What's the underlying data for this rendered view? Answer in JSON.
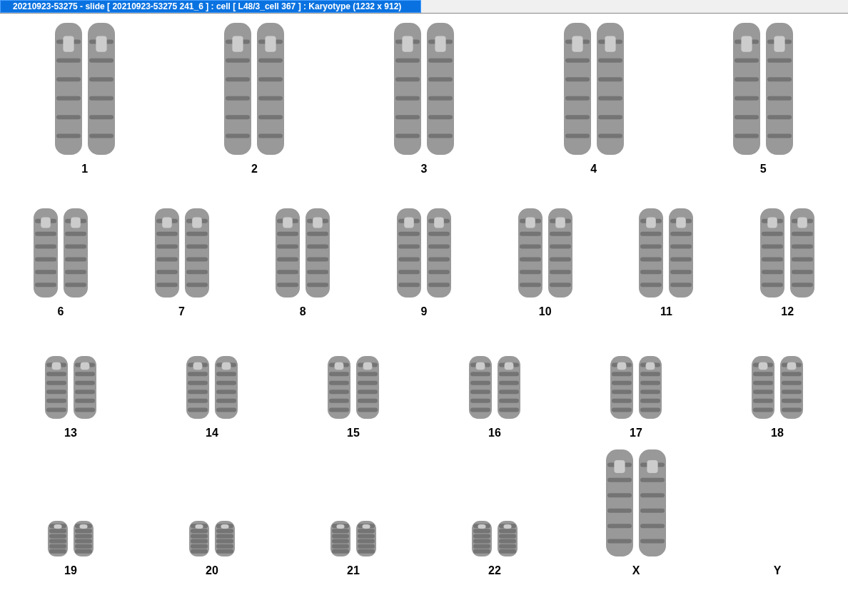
{
  "window": {
    "title": "20210923-53275 - slide [ 20210923-53275 241_6 ] : cell [ L48/3_cell 367 ] : Karyotype  (1232 x 912)"
  },
  "karyotype": {
    "rows": [
      {
        "chromosomes": [
          {
            "label": "1",
            "kind": "pair"
          },
          {
            "label": "2",
            "kind": "pair"
          },
          {
            "label": "3",
            "kind": "pair"
          },
          {
            "label": "4",
            "kind": "pair"
          },
          {
            "label": "5",
            "kind": "pair"
          }
        ]
      },
      {
        "chromosomes": [
          {
            "label": "6",
            "kind": "pair"
          },
          {
            "label": "7",
            "kind": "pair"
          },
          {
            "label": "8",
            "kind": "pair"
          },
          {
            "label": "9",
            "kind": "pair"
          },
          {
            "label": "10",
            "kind": "pair"
          },
          {
            "label": "11",
            "kind": "pair"
          },
          {
            "label": "12",
            "kind": "pair"
          }
        ]
      },
      {
        "chromosomes": [
          {
            "label": "13",
            "kind": "pair"
          },
          {
            "label": "14",
            "kind": "pair"
          },
          {
            "label": "15",
            "kind": "pair"
          },
          {
            "label": "16",
            "kind": "pair"
          },
          {
            "label": "17",
            "kind": "pair"
          },
          {
            "label": "18",
            "kind": "pair"
          }
        ]
      },
      {
        "chromosomes": [
          {
            "label": "19",
            "kind": "pair"
          },
          {
            "label": "20",
            "kind": "pair"
          },
          {
            "label": "21",
            "kind": "pair"
          },
          {
            "label": "22",
            "kind": "pair"
          },
          {
            "label": "X",
            "kind": "pair"
          },
          {
            "label": "Y",
            "kind": "none"
          }
        ]
      }
    ]
  }
}
